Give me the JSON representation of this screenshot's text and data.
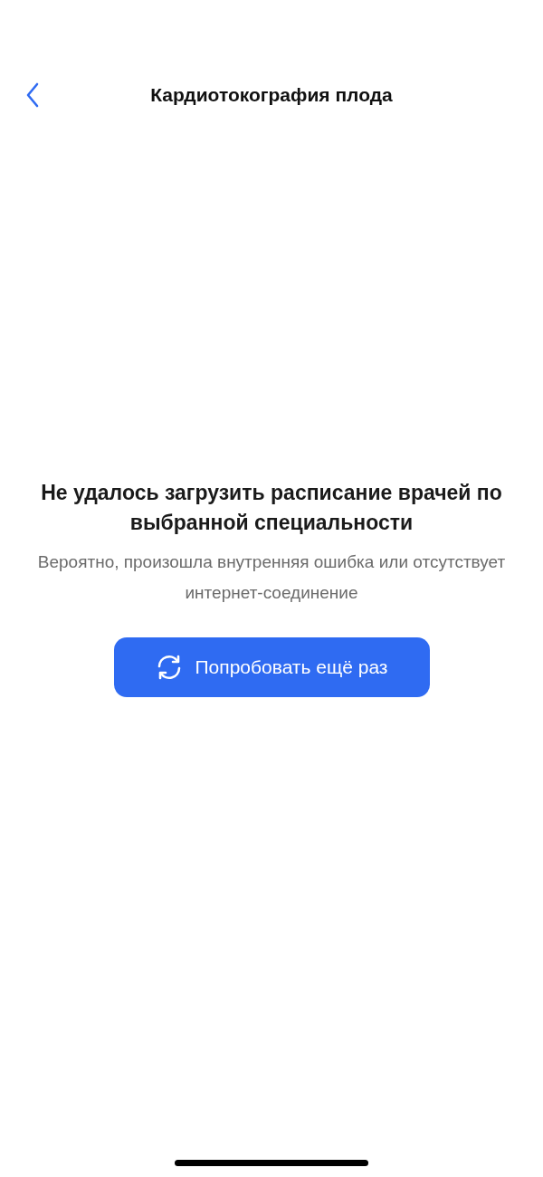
{
  "header": {
    "title": "Кардиотокография плода"
  },
  "error": {
    "title": "Не удалось загрузить расписание врачей по выбранной специальности",
    "message": "Вероятно, произошла внутренняя ошибка или отсутствует интернет-соединение"
  },
  "retry_button": {
    "label": "Попробовать ещё раз"
  }
}
